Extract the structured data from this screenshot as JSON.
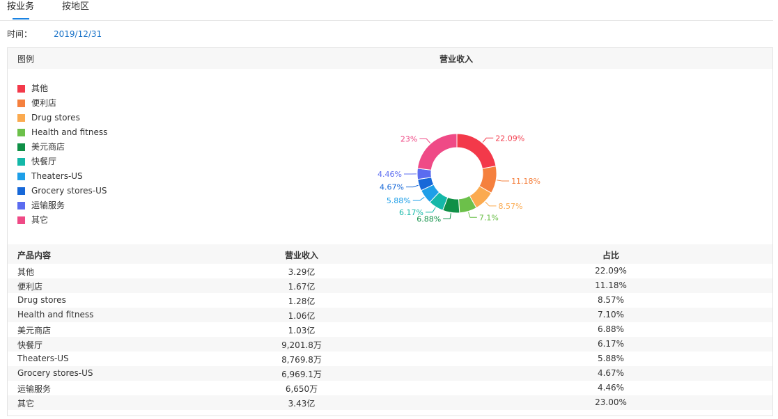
{
  "tabs": [
    {
      "label": "按业务"
    },
    {
      "label": "按地区"
    }
  ],
  "date": {
    "label": "时间：",
    "value": "2019/12/31"
  },
  "panel": {
    "legend_title": "图例",
    "chart_title": "营业收入"
  },
  "table": {
    "headers": [
      "产品内容",
      "营业收入",
      "占比"
    ],
    "rows": [
      [
        "其他",
        "3.29亿",
        "22.09%"
      ],
      [
        "便利店",
        "1.67亿",
        "11.18%"
      ],
      [
        "Drug stores",
        "1.28亿",
        "8.57%"
      ],
      [
        "Health and fitness",
        "1.06亿",
        "7.10%"
      ],
      [
        "美元商店",
        "1.03亿",
        "6.88%"
      ],
      [
        "快餐厅",
        "9,201.8万",
        "6.17%"
      ],
      [
        "Theaters-US",
        "8,769.8万",
        "5.88%"
      ],
      [
        "Grocery stores-US",
        "6,969.1万",
        "4.67%"
      ],
      [
        "运输服务",
        "6,650万",
        "4.46%"
      ],
      [
        "其它",
        "3.43亿",
        "23.00%"
      ]
    ]
  },
  "chart_data": {
    "type": "pie",
    "title": "营业收入",
    "categories": [
      "其他",
      "便利店",
      "Drug stores",
      "Health and fitness",
      "美元商店",
      "快餐厅",
      "Theaters-US",
      "Grocery stores-US",
      "运输服务",
      "其它"
    ],
    "values": [
      22.09,
      11.18,
      8.57,
      7.1,
      6.88,
      6.17,
      5.88,
      4.67,
      4.46,
      23
    ],
    "labels": [
      "22.09%",
      "11.18%",
      "8.57%",
      "7.1%",
      "6.88%",
      "6.17%",
      "5.88%",
      "4.67%",
      "4.46%",
      "23%"
    ],
    "colors": [
      "#f3394a",
      "#f5803e",
      "#fbaa4f",
      "#6cc04a",
      "#0f9047",
      "#14b8a8",
      "#1e9fe8",
      "#1768d8",
      "#5b6cf0",
      "#ef4a86"
    ],
    "legend_placement": "left",
    "donut": true
  }
}
